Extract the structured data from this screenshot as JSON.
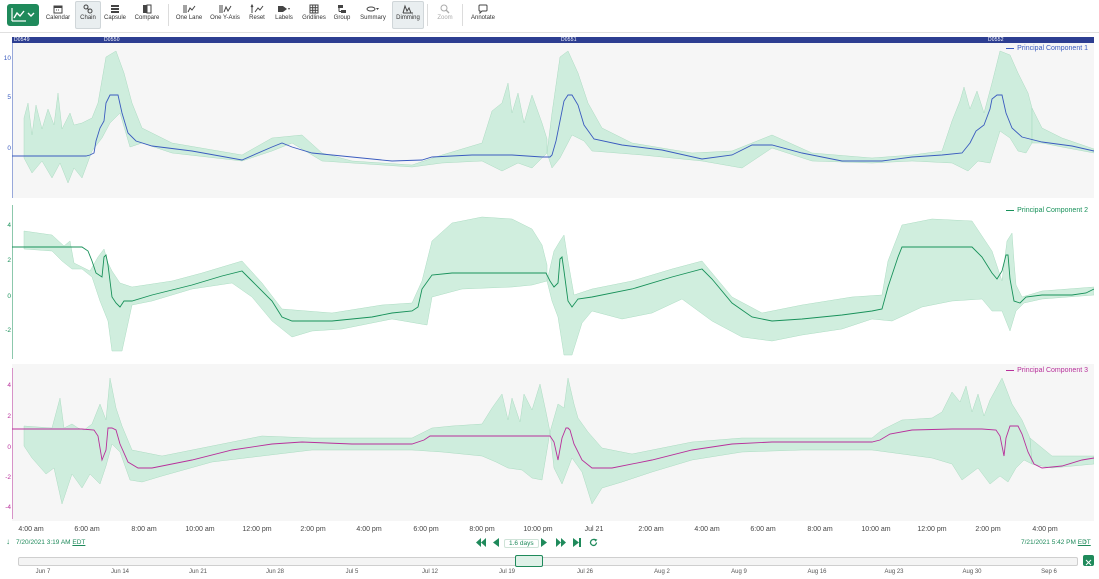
{
  "toolbar": {
    "buttons": [
      {
        "label": "Calendar",
        "icon": "calendar-icon"
      },
      {
        "label": "Chain",
        "icon": "link-icon"
      },
      {
        "label": "Capsule",
        "icon": "capsule-icon"
      },
      {
        "label": "Compare",
        "icon": "compare-icon"
      },
      {
        "label": "One Lane",
        "icon": "one-lane-icon"
      },
      {
        "label": "One Y-Axis",
        "icon": "one-y-axis-icon"
      },
      {
        "label": "Reset",
        "icon": "reset-icon"
      },
      {
        "label": "Labels",
        "icon": "tag-icon"
      },
      {
        "label": "Gridlines",
        "icon": "grid-icon"
      },
      {
        "label": "Group",
        "icon": "group-icon"
      },
      {
        "label": "Summary",
        "icon": "summary-icon"
      },
      {
        "label": "Dimming",
        "icon": "dimming-icon"
      },
      {
        "label": "Zoom",
        "icon": "zoom-icon"
      },
      {
        "label": "Annotate",
        "icon": "comment-icon"
      }
    ]
  },
  "capsules": [
    "D0549",
    "D0550",
    "D0551",
    "D0552"
  ],
  "lanes": [
    {
      "series": "Principal Component 1",
      "color": "#3a5bbf",
      "yticks": [
        "10",
        "5",
        "0"
      ]
    },
    {
      "series": "Principal Component 2",
      "color": "#18915a",
      "yticks": [
        "4",
        "2",
        "0",
        "-2"
      ]
    },
    {
      "series": "Principal Component 3",
      "color": "#b8309b",
      "yticks": [
        "4",
        "2",
        "0",
        "-2",
        "-4"
      ]
    }
  ],
  "band_color": "#c8ecd9",
  "x_axis": [
    "4:00 am",
    "6:00 am",
    "8:00 am",
    "10:00 am",
    "12:00 pm",
    "2:00 pm",
    "4:00 pm",
    "6:00 pm",
    "8:00 pm",
    "10:00 pm",
    "Jul 21",
    "2:00 am",
    "4:00 am",
    "6:00 am",
    "8:00 am",
    "10:00 am",
    "12:00 pm",
    "2:00 pm",
    "4:00 pm"
  ],
  "nav": {
    "start": "7/20/2021 3:19 AM",
    "start_tz": "EDT",
    "end": "7/21/2021 5:42 PM",
    "end_tz": "EDT",
    "duration": "1.6 days"
  },
  "timeline_ticks": [
    "Jun 7",
    "Jun 14",
    "Jun 21",
    "Jun 28",
    "Jul 5",
    "Jul 12",
    "Jul 19",
    "Jul 26",
    "Aug 2",
    "Aug 9",
    "Aug 16",
    "Aug 23",
    "Aug 30",
    "Sep 6"
  ]
}
